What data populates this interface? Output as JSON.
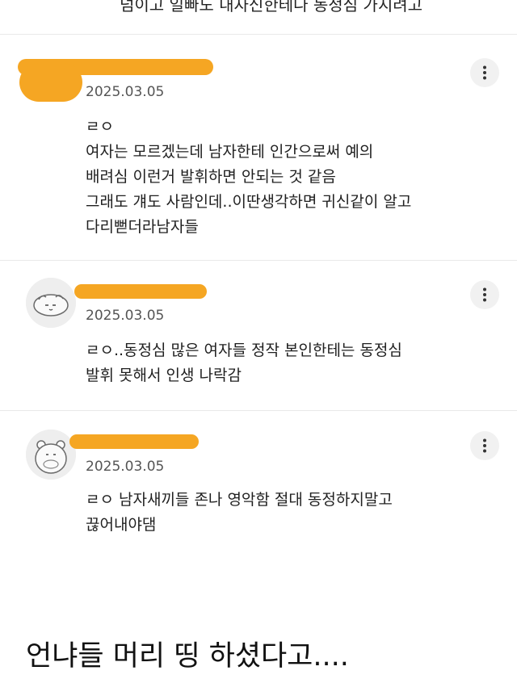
{
  "header_cut_text": "넘이고 일빠도 내자신한테나 동정심 가지려고",
  "comments": [
    {
      "date": "2025.03.05",
      "text": "ㄹㅇ\n여자는 모르겠는데 남자한테 인간으로써 예의\n배려심 이런거 발휘하면 안되는 것 같음\n그래도 걔도 사람인데..이딴생각하면 귀신같이 알고\n다리뻗더라남자들",
      "more_icon": "vertical-dots-icon"
    },
    {
      "date": "2025.03.05",
      "text": "ㄹㅇ..동정심 많은 여자들 정작 본인한테는 동정심\n발휘 못해서 인생 나락감",
      "more_icon": "vertical-dots-icon"
    },
    {
      "date": "2025.03.05",
      "text": "ㄹㅇ 남자새끼들 존나 영악함 절대 동정하지말고\n끊어내야댐",
      "more_icon": "vertical-dots-icon"
    }
  ],
  "caption": "언냐들 머리 띵 하셨다고....",
  "colors": {
    "redaction": "#f5a623",
    "divider": "#e9e9e9",
    "date_text": "#555555"
  }
}
